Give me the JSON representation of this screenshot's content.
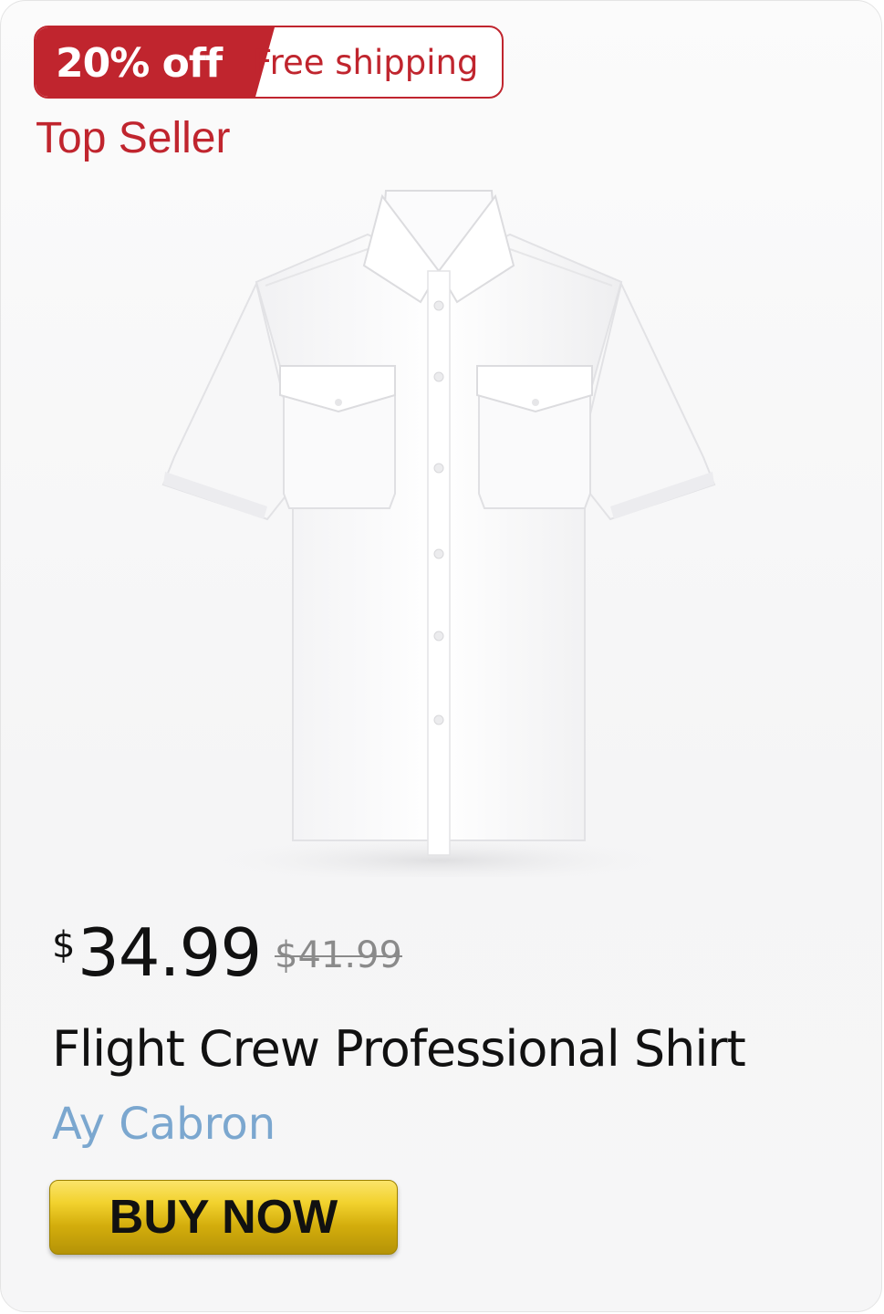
{
  "badges": {
    "discount": "20% off",
    "shipping": "Free shipping",
    "seller": "Top Seller"
  },
  "product": {
    "currency_symbol": "$",
    "price": "34.99",
    "original_price": "$41.99",
    "title": "Flight Crew Professional Shirt",
    "brand": "Ay Cabron",
    "image_icon": "short-sleeve-white-shirt"
  },
  "actions": {
    "buy_label": "BUY NOW"
  },
  "colors": {
    "accent_red": "#c0252e",
    "brand_blue": "#7ba7cf",
    "button_gold": "#e6c21c"
  }
}
